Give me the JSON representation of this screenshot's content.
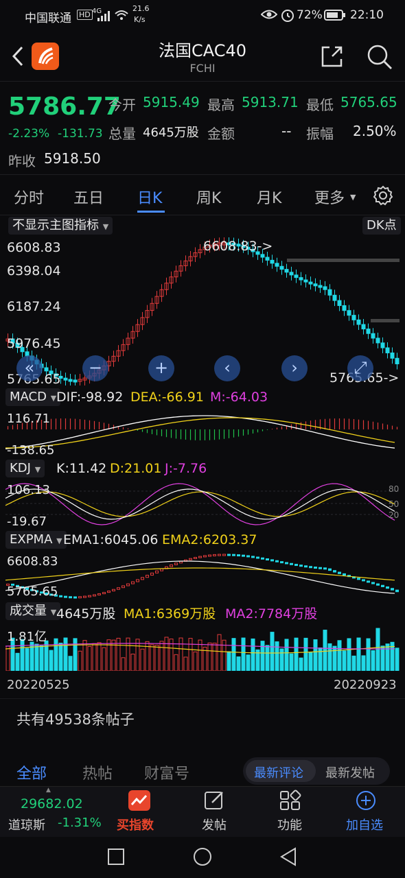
{
  "status_bar": {
    "carrier": "中国联通",
    "network": "4G",
    "speed_value": "21.6",
    "speed_unit": "K/s",
    "battery": "72%",
    "time": "22:10"
  },
  "header": {
    "title": "法国CAC40",
    "subtitle": "FCHI"
  },
  "quote": {
    "price": "5786.77",
    "change_pct": "-2.23%",
    "change_abs": "-131.73",
    "prev_close_label": "昨收",
    "prev_close": "5918.50",
    "open_label": "今开",
    "open": "5915.49",
    "high_label": "最高",
    "high": "5913.71",
    "low_label": "最低",
    "low": "5765.65",
    "volume_label": "总量",
    "volume": "4645万股",
    "amount_label": "金额",
    "amount": "--",
    "amplitude_label": "振幅",
    "amplitude": "2.50%"
  },
  "tabs": [
    "分时",
    "五日",
    "日K",
    "周K",
    "月K",
    "更多"
  ],
  "active_tab": "日K",
  "chart_controls": {
    "indicator_dropdown": "不显示主图指标",
    "dk_button": "DK点"
  },
  "main_chart": {
    "y_labels": [
      "6608.83",
      "6398.04",
      "6187.24",
      "5976.45",
      "5765.65"
    ],
    "high_marker": "6608.83->",
    "low_marker": "5765.65->"
  },
  "macd": {
    "name": "MACD",
    "dif": "DIF:-98.92",
    "dea": "DEA:-66.91",
    "m": "M:-64.03",
    "y_top": "116.71",
    "y_bottom": "-138.65"
  },
  "kdj": {
    "name": "KDJ",
    "k": "K:11.42",
    "d": "D:21.01",
    "j": "J:-7.76",
    "y_top": "106.13",
    "y_bottom": "-19.67",
    "ref_lines": [
      "80",
      "50",
      "20"
    ]
  },
  "expma": {
    "name": "EXPMA",
    "ema1": "EMA1:6045.06",
    "ema2": "EMA2:6203.37",
    "y_top": "6608.83",
    "y_bottom": "5765.65"
  },
  "volume_panel": {
    "name": "成交量",
    "value": "4645万股",
    "ma1": "MA1:6369万股",
    "ma2": "MA2:7784万股",
    "y_top": "1.81亿"
  },
  "dates": {
    "start": "20220525",
    "end": "20220923"
  },
  "posts": {
    "count_text": "共有49538条帖子"
  },
  "post_tabs": [
    "全部",
    "热帖",
    "财富号"
  ],
  "post_sort": [
    "最新评论",
    "最新发帖"
  ],
  "bottom_bar": {
    "ticker_value": "29682.02",
    "ticker_name": "道琼斯",
    "ticker_change": "-1.31%",
    "items": [
      "买指数",
      "发帖",
      "功能",
      "加自选"
    ]
  },
  "colors": {
    "up": "#e23b3b",
    "down": "#20d8e6",
    "green_text": "#21d07a",
    "accent": "#4a8cff",
    "yellow": "#f1d21a",
    "magenta": "#e040e0"
  }
}
